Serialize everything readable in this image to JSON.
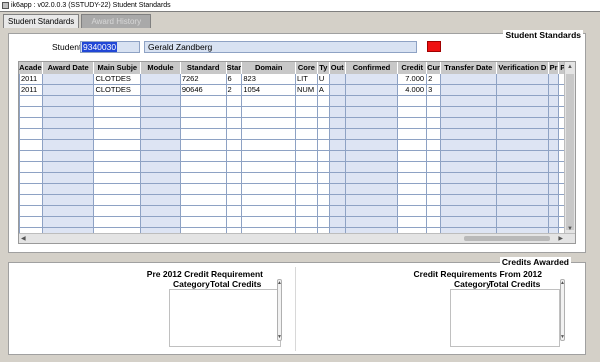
{
  "window": {
    "title": "ik6app : v02.0.0.3 (SSTUDY-22) Student Standards"
  },
  "tabs": [
    {
      "label": "Student Standards",
      "active": true
    },
    {
      "label": "Award History",
      "active": false
    }
  ],
  "student_section": {
    "legend": "Student Standards",
    "student_label": "Student",
    "student_id": "9340030",
    "student_name": "Gerald Zandberg"
  },
  "grid": {
    "columns": [
      "Acade",
      "Award Date",
      "Main Subje",
      "Module",
      "Standard",
      "Star",
      "Domain",
      "Core",
      "Ty",
      "Out",
      "Confirmed",
      "Credit",
      "Cur",
      "Transfer Date",
      "Verification D",
      "Pr",
      "Pro"
    ],
    "rows": [
      [
        "2011",
        "",
        "CLOTDES",
        "",
        "7262",
        "6",
        "823",
        "LIT",
        "U",
        "",
        "",
        "7.000",
        "2",
        "",
        "",
        "",
        ""
      ],
      [
        "2011",
        "",
        "CLOTDES",
        "",
        "90646",
        "2",
        "1054",
        "NUM",
        "A",
        "",
        "",
        "4.000",
        "3",
        "",
        "",
        "",
        ""
      ]
    ],
    "empty_rows": 13
  },
  "credits_section": {
    "legend": "Credits Awarded",
    "left_heading": "Pre 2012 Credit Requirement",
    "left_category_header": "Category",
    "left_total_header": "Total Credits",
    "right_heading": "Credit Requirements From 2012",
    "right_category_header": "Category",
    "right_total_header": "Total Credits"
  },
  "colors": {
    "background": "#d4d0c8",
    "panel": "#ffffff",
    "field": "#d8e2f2",
    "selection": "#2147d6",
    "red_button": "#ee1111"
  }
}
